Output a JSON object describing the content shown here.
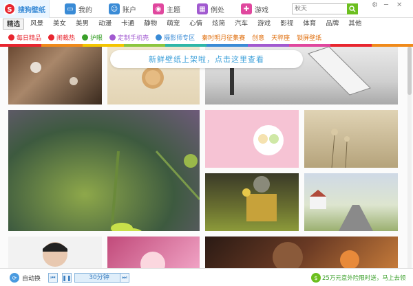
{
  "tabs": [
    {
      "label": "搜狗壁纸",
      "icon": "sogou-logo-icon",
      "color": "#e8262f",
      "active": true
    },
    {
      "label": "我的",
      "icon": "monitor-icon",
      "color": "#3a8bd6"
    },
    {
      "label": "账户",
      "icon": "user-icon",
      "color": "#3a8bd6"
    },
    {
      "label": "主题",
      "icon": "theme-icon",
      "color": "#e0479e"
    },
    {
      "label": "例处",
      "icon": "calendar-icon",
      "color": "#a15ad0"
    },
    {
      "label": "游戏",
      "icon": "gamepad-icon",
      "color": "#e0479e"
    }
  ],
  "search": {
    "placeholder": "秋天"
  },
  "categories": [
    "精选",
    "风景",
    "美女",
    "美男",
    "动漫",
    "卡通",
    "静物",
    "萌宠",
    "心情",
    "炫简",
    "汽车",
    "游戏",
    "影视",
    "体育",
    "品牌",
    "其他"
  ],
  "specials": [
    {
      "label": "每日精品",
      "color": "#e8262f"
    },
    {
      "label": "闹裁热",
      "color": "#e8262f"
    },
    {
      "label": "护眼",
      "color": "#3aa02a"
    },
    {
      "label": "定制手机壳",
      "color": "#a15ad0"
    },
    {
      "label": "摄影师专区",
      "color": "#3a8bd6"
    },
    {
      "label": "秦时明月征集赛",
      "color": "#e07010"
    },
    {
      "label": "创意",
      "color": "#e07010"
    },
    {
      "label": "天秤座",
      "color": "#e07010"
    },
    {
      "label": "锁屏壁纸",
      "color": "#e07010"
    }
  ],
  "notice": "新鲜壁纸上架啦，点击这里查看",
  "bottom": {
    "auto_label": "自动换",
    "interval": "30分钟",
    "promo": "25万元意外险限时送，马上去领"
  },
  "colors": {
    "accent": "#3a8bd6",
    "green": "#6cbf1f"
  }
}
